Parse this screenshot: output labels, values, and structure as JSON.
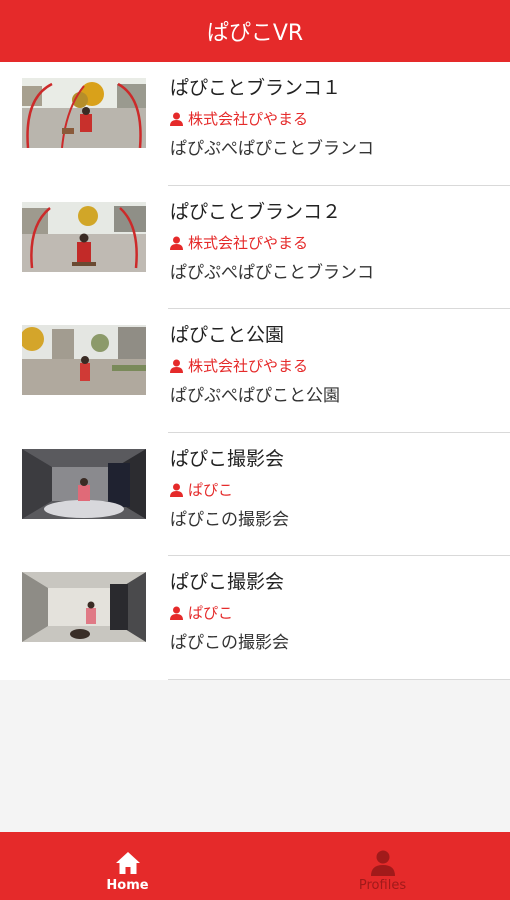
{
  "header": {
    "title": "ぱぴこVR"
  },
  "items": [
    {
      "title": "ぱぴことブランコ１",
      "author": "株式会社ぴやまる",
      "description": "ぱぴぷぺぱぴことブランコ",
      "thumb": "park-swing"
    },
    {
      "title": "ぱぴことブランコ２",
      "author": "株式会社ぴやまる",
      "description": "ぱぴぷぺぱぴことブランコ",
      "thumb": "park-swing"
    },
    {
      "title": "ぱぴこと公園",
      "author": "株式会社ぴやまる",
      "description": "ぱぴぷぺぱぴこと公園",
      "thumb": "park"
    },
    {
      "title": "ぱぴこ撮影会",
      "author": "ぱぴこ",
      "description": "ぱぴこの撮影会",
      "thumb": "studio-dark"
    },
    {
      "title": "ぱぴこ撮影会",
      "author": "ぱぴこ",
      "description": "ぱぴこの撮影会",
      "thumb": "studio-light"
    }
  ],
  "tabbar": {
    "home_label": "Home",
    "profiles_label": "Profiles"
  },
  "colors": {
    "accent": "#e52a2a",
    "inactive": "#a11a1a"
  }
}
